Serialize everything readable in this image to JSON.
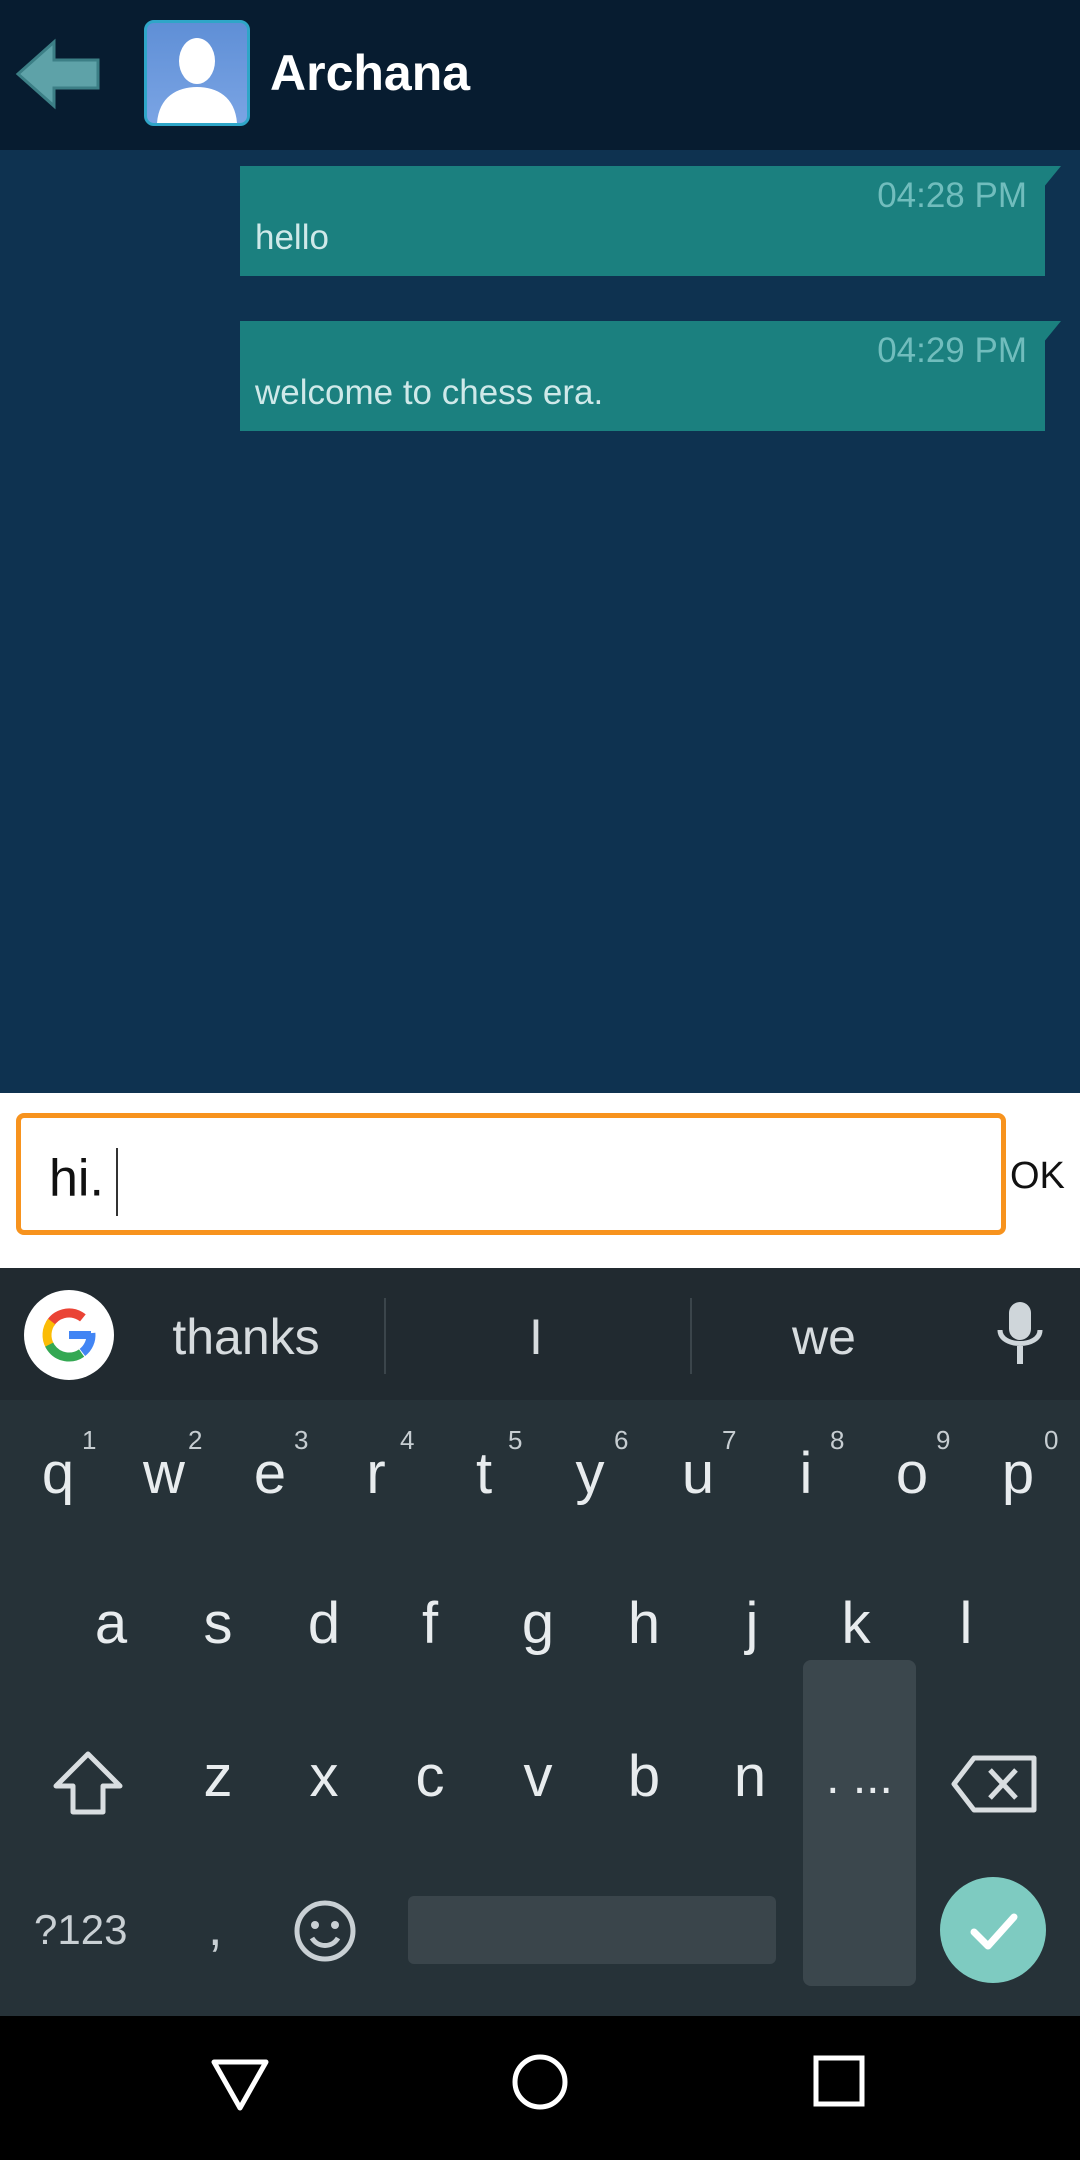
{
  "header": {
    "contact_name": "Archana"
  },
  "messages": [
    {
      "time": "04:28 PM",
      "text": "hello"
    },
    {
      "time": "04:29 PM",
      "text": "welcome to chess era."
    }
  ],
  "composer": {
    "value": "hi.",
    "send_label": "OK"
  },
  "keyboard": {
    "suggestions": [
      "thanks",
      "I",
      "we"
    ],
    "row1": [
      "q",
      "w",
      "e",
      "r",
      "t",
      "y",
      "u",
      "i",
      "o",
      "p"
    ],
    "row1_hints": [
      "1",
      "2",
      "3",
      "4",
      "5",
      "6",
      "7",
      "8",
      "9",
      "0"
    ],
    "row2": [
      "a",
      "s",
      "d",
      "f",
      "g",
      "h",
      "j",
      "k",
      "l"
    ],
    "row3": [
      "z",
      "x",
      "c",
      "v",
      "b",
      "n"
    ],
    "period_popup": ". ...",
    "symbols_key": "?123",
    "comma_key": ","
  },
  "colors": {
    "header_bg": "#071c30",
    "chat_bg": "#0e3250",
    "bubble": "#1b807f",
    "input_border": "#f7931e",
    "keyboard_bg": "#263238",
    "enter_key": "#7ecbc1"
  },
  "icons": {
    "back": "back-arrow-icon",
    "avatar": "user-silhouette-icon",
    "google": "google-icon",
    "mic": "mic-icon",
    "shift": "shift-icon",
    "backspace": "backspace-icon",
    "emoji": "emoji-icon",
    "enter": "check-icon",
    "nav_back": "nav-back-icon",
    "nav_home": "nav-home-icon",
    "nav_recents": "nav-recents-icon"
  }
}
